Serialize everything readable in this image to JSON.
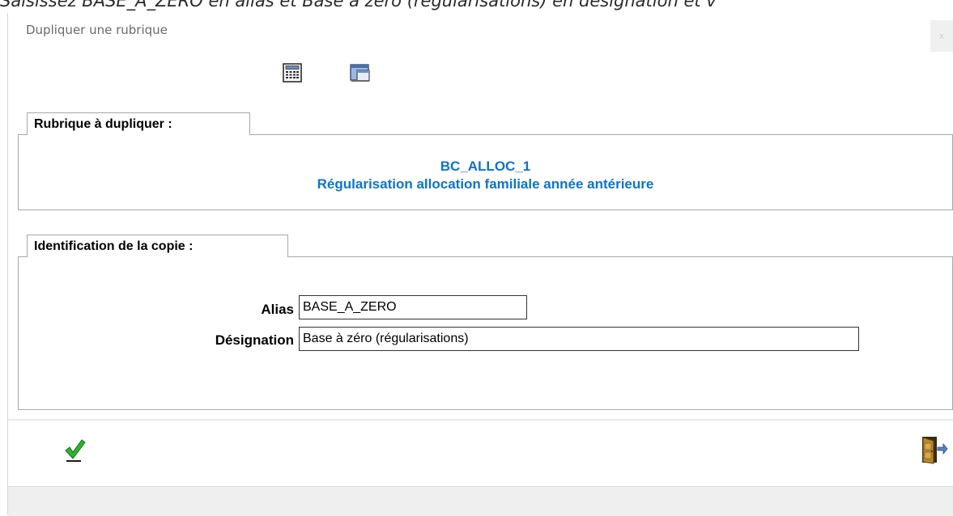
{
  "instruction_text": "Saisissez BASE_A_ZERO en alias et Base à zéro (régularisations) en désignation et v",
  "dialog": {
    "title": "Dupliquer une rubrique",
    "close_label": "x"
  },
  "toolbar": {
    "icons": [
      "calculator-icon",
      "window-screen-icon"
    ]
  },
  "source_group": {
    "tab_label": "Rubrique à dupliquer :",
    "alias": "BC_ALLOC_1",
    "designation": "Régularisation allocation familiale année antérieure",
    "text_color": "#0a74d1"
  },
  "copy_group": {
    "tab_label": "Identification de la copie :",
    "alias_label": "Alias",
    "alias_value": "BASE_A_ZERO",
    "designation_label": "Désignation",
    "designation_value": "Base à zéro (régularisations)"
  },
  "actions": {
    "validate_icon": "green-checkmark-icon",
    "exit_icon": "exit-door-icon"
  }
}
